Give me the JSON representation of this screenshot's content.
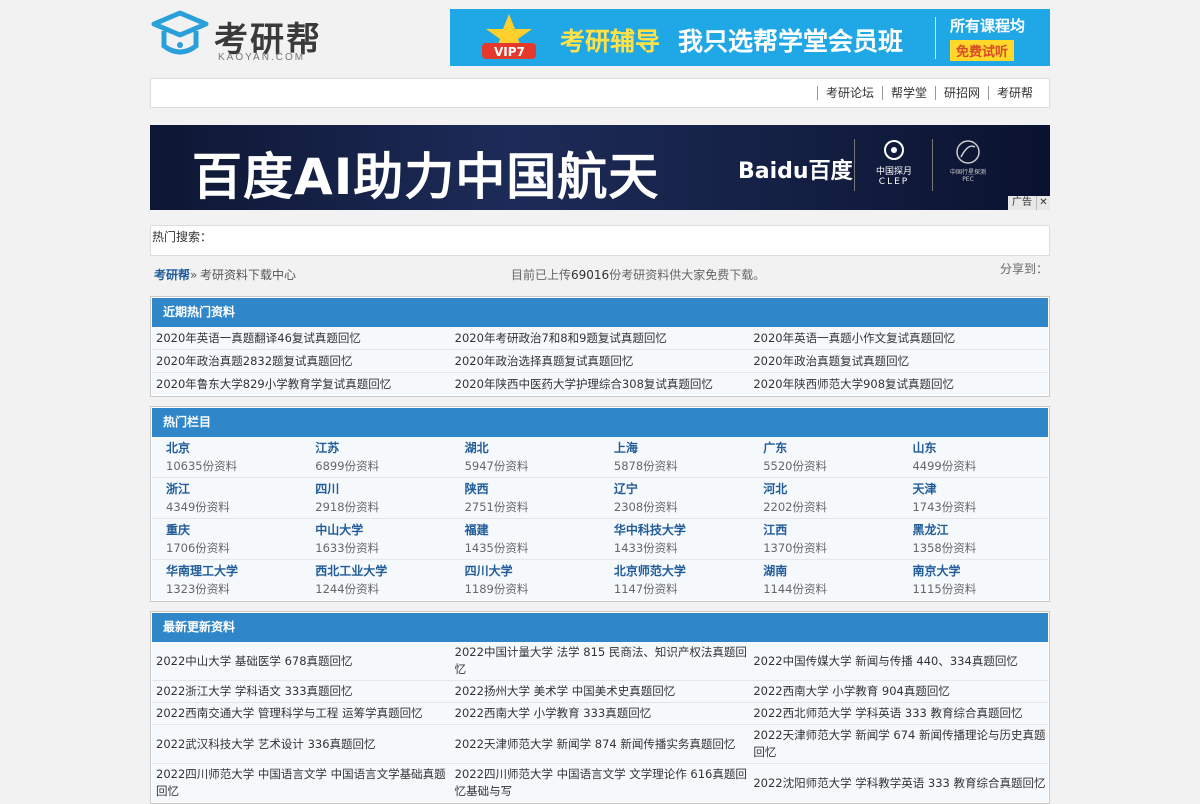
{
  "logo": {
    "text": "考研帮",
    "sub": "KAOYAN.COM"
  },
  "top_ad": {
    "badge": "VIP7",
    "t1": "考研辅导",
    "t2": "我只选帮学堂会员班",
    "t3": "所有课程均",
    "t4": "免费试听"
  },
  "nav": [
    "考研论坛",
    "帮学堂",
    "研招网",
    "考研帮"
  ],
  "big_ad": {
    "main": "百度AI助力中国航天",
    "baidu": "Baidu百度",
    "clep_cn": "中国探月",
    "clep_en": "CLEP",
    "pec_cn": "中国行星探测",
    "pec_en": "PEC",
    "ad_tag": "广告",
    "close": "✕"
  },
  "hot_search_label": "热门搜索：",
  "crumb": {
    "home": "考研帮",
    "sep": " » ",
    "current": "考研资料下载中心",
    "stat_pre": "目前已上传",
    "stat_num": "69016",
    "stat_post": "份考研资料供大家免费下载。",
    "share": "分享到："
  },
  "hot_recent": {
    "title": "近期热门资料",
    "rows": [
      [
        "2020年英语一真题翻译46复试真题回忆",
        "2020年考研政治7和8和9题复试真题回忆",
        "2020年英语一真题小作文复试真题回忆"
      ],
      [
        "2020年政治真题2832题复试真题回忆",
        "2020年政治选择真题复试真题回忆",
        "2020年政治真题复试真题回忆"
      ],
      [
        "2020年鲁东大学829小学教育学复试真题回忆",
        "2020年陕西中医药大学护理综合308复试真题回忆",
        "2020年陕西师范大学908复试真题回忆"
      ]
    ]
  },
  "hot_columns": {
    "title": "热门栏目",
    "rows": [
      [
        {
          "name": "北京",
          "count": "10635份资料"
        },
        {
          "name": "江苏",
          "count": "6899份资料"
        },
        {
          "name": "湖北",
          "count": "5947份资料"
        },
        {
          "name": "上海",
          "count": "5878份资料"
        },
        {
          "name": "广东",
          "count": "5520份资料"
        },
        {
          "name": "山东",
          "count": "4499份资料"
        }
      ],
      [
        {
          "name": "浙江",
          "count": "4349份资料"
        },
        {
          "name": "四川",
          "count": "2918份资料"
        },
        {
          "name": "陕西",
          "count": "2751份资料"
        },
        {
          "name": "辽宁",
          "count": "2308份资料"
        },
        {
          "name": "河北",
          "count": "2202份资料"
        },
        {
          "name": "天津",
          "count": "1743份资料"
        }
      ],
      [
        {
          "name": "重庆",
          "count": "1706份资料"
        },
        {
          "name": "中山大学",
          "count": "1633份资料"
        },
        {
          "name": "福建",
          "count": "1435份资料"
        },
        {
          "name": "华中科技大学",
          "count": "1433份资料"
        },
        {
          "name": "江西",
          "count": "1370份资料"
        },
        {
          "name": "黑龙江",
          "count": "1358份资料"
        }
      ],
      [
        {
          "name": "华南理工大学",
          "count": "1323份资料"
        },
        {
          "name": "西北工业大学",
          "count": "1244份资料"
        },
        {
          "name": "四川大学",
          "count": "1189份资料"
        },
        {
          "name": "北京师范大学",
          "count": "1147份资料"
        },
        {
          "name": "湖南",
          "count": "1144份资料"
        },
        {
          "name": "南京大学",
          "count": "1115份资料"
        }
      ]
    ]
  },
  "latest": {
    "title": "最新更新资料",
    "rows": [
      [
        "2022中山大学 基础医学 678真题回忆",
        "2022中国计量大学 法学 815 民商法、知识产权法真题回忆",
        "2022中国传媒大学 新闻与传播 440、334真题回忆"
      ],
      [
        "2022浙江大学 学科语文 333真题回忆",
        "2022扬州大学 美术学 中国美术史真题回忆",
        "2022西南大学 小学教育 904真题回忆"
      ],
      [
        "2022西南交通大学 管理科学与工程 运筹学真题回忆",
        "2022西南大学 小学教育 333真题回忆",
        "2022西北师范大学 学科英语 333 教育综合真题回忆"
      ],
      [
        "2022武汉科技大学 艺术设计 336真题回忆",
        "2022天津师范大学 新闻学 874 新闻传播实务真题回忆",
        "2022天津师范大学 新闻学 674 新闻传播理论与历史真题回忆"
      ],
      [
        "2022四川师范大学 中国语言文学 中国语言文学基础真题回忆",
        "2022四川师范大学 中国语言文学 文学理论作 616真题回忆基础与写",
        "2022沈阳师范大学 学科教学英语 333 教育综合真题回忆"
      ]
    ]
  },
  "colors": {
    "accent": "#2f87c9",
    "link": "#225d9a",
    "ad_blue": "#20a7e6"
  }
}
